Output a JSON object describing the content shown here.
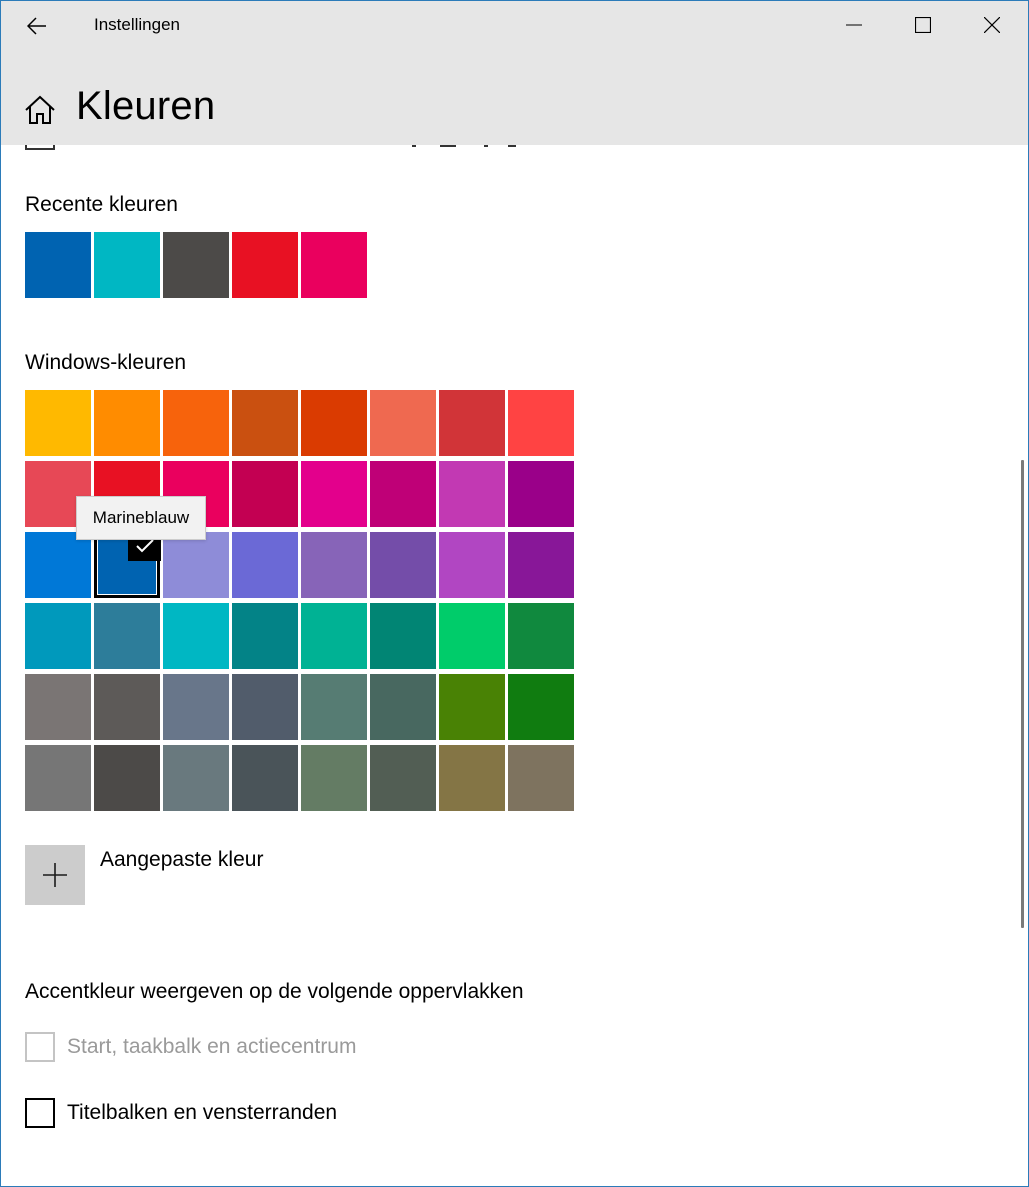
{
  "window": {
    "app_title": "Instellingen",
    "back_icon": "back-arrow-icon",
    "minimize_icon": "minimize-icon",
    "maximize_icon": "maximize-icon",
    "close_icon": "close-icon"
  },
  "page": {
    "title": "Kleuren",
    "home_icon": "home-icon"
  },
  "recent": {
    "label": "Recente kleuren",
    "colors": [
      "#0063b1",
      "#00b7c3",
      "#4c4a48",
      "#e81123",
      "#ea005e"
    ]
  },
  "windows_colors": {
    "label": "Windows-kleuren",
    "rows": [
      [
        "#ffb900",
        "#ff8c00",
        "#f7630c",
        "#ca5010",
        "#da3b01",
        "#ef6950",
        "#d13438",
        "#ff4343"
      ],
      [
        "#e74856",
        "#e81123",
        "#ea005e",
        "#c30052",
        "#e3008c",
        "#bf0077",
        "#c239b3",
        "#9a0089"
      ],
      [
        "#0078d7",
        "#0063b1",
        "#8e8cd8",
        "#6b69d6",
        "#8764b8",
        "#744da9",
        "#b146c2",
        "#881798"
      ],
      [
        "#0099bc",
        "#2d7d9a",
        "#00b7c3",
        "#038387",
        "#00b294",
        "#018574",
        "#00cc6a",
        "#10893e"
      ],
      [
        "#7a7574",
        "#5d5a58",
        "#68768a",
        "#515c6b",
        "#567c73",
        "#486860",
        "#498205",
        "#107c10"
      ],
      [
        "#767676",
        "#4c4a48",
        "#69797e",
        "#4a5459",
        "#647c64",
        "#525e54",
        "#847545",
        "#7e735f"
      ]
    ],
    "selected": "Marineblauw",
    "check_icon": "checkmark-icon"
  },
  "custom_color": {
    "label": "Aangepaste kleur",
    "icon": "plus-icon"
  },
  "surfaces": {
    "heading": "Accentkleur weergeven op de volgende oppervlakken",
    "options": [
      {
        "label": "Start, taakbalk en actiecentrum",
        "checked": false,
        "disabled": true
      },
      {
        "label": "Titelbalken en vensterranden",
        "checked": false,
        "disabled": false
      }
    ]
  }
}
